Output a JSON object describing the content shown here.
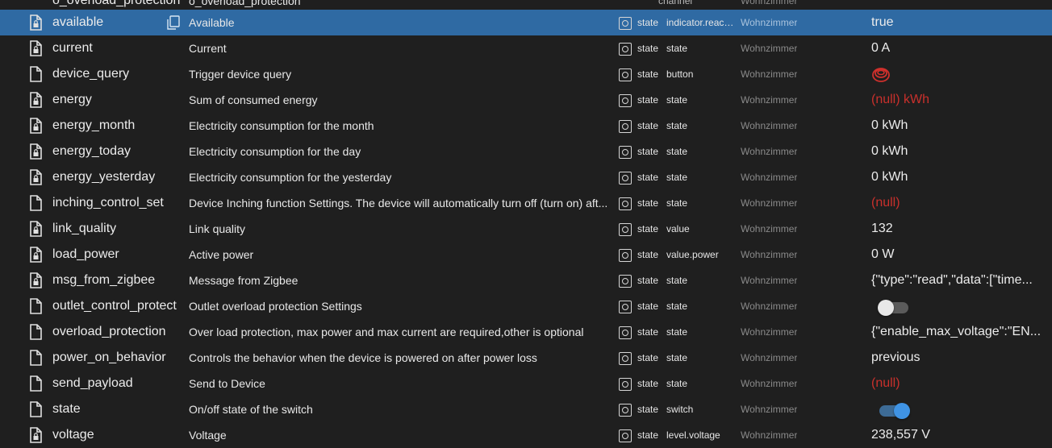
{
  "partial_row": {
    "id": "o_overload_protection",
    "name": "o_overload_protection",
    "type": "channel",
    "room": "Wohnzimmer"
  },
  "rows": [
    {
      "id": "available",
      "name": "Available",
      "type": "state",
      "role": "indicator.reach...",
      "room": "Wohnzimmer",
      "value": "true",
      "kind": "text",
      "selected": true,
      "icon": "file-lock-icon"
    },
    {
      "id": "current",
      "name": "Current",
      "type": "state",
      "role": "state",
      "room": "Wohnzimmer",
      "value": "0 A",
      "kind": "text",
      "icon": "file-lock-icon"
    },
    {
      "id": "device_query",
      "name": "Trigger device query",
      "type": "state",
      "role": "button",
      "room": "Wohnzimmer",
      "value": "",
      "kind": "button",
      "icon": "file-icon"
    },
    {
      "id": "energy",
      "name": "Sum of consumed energy",
      "type": "state",
      "role": "state",
      "room": "Wohnzimmer",
      "value": "(null) kWh",
      "kind": "null",
      "icon": "file-lock-icon"
    },
    {
      "id": "energy_month",
      "name": "Electricity consumption for the month",
      "type": "state",
      "role": "state",
      "room": "Wohnzimmer",
      "value": "0 kWh",
      "kind": "text",
      "icon": "file-lock-icon"
    },
    {
      "id": "energy_today",
      "name": "Electricity consumption for the day",
      "type": "state",
      "role": "state",
      "room": "Wohnzimmer",
      "value": "0 kWh",
      "kind": "text",
      "icon": "file-lock-icon"
    },
    {
      "id": "energy_yesterday",
      "name": "Electricity consumption for the yesterday",
      "type": "state",
      "role": "state",
      "room": "Wohnzimmer",
      "value": "0 kWh",
      "kind": "text",
      "icon": "file-lock-icon"
    },
    {
      "id": "inching_control_set",
      "name": "Device Inching function Settings. The device will automatically turn off (turn on) aft...",
      "type": "state",
      "role": "state",
      "room": "Wohnzimmer",
      "value": "(null)",
      "kind": "null",
      "icon": "file-icon"
    },
    {
      "id": "link_quality",
      "name": "Link quality",
      "type": "state",
      "role": "value",
      "room": "Wohnzimmer",
      "value": "132",
      "kind": "text",
      "icon": "file-lock-icon"
    },
    {
      "id": "load_power",
      "name": "Active power",
      "type": "state",
      "role": "value.power",
      "room": "Wohnzimmer",
      "value": "0 W",
      "kind": "text",
      "icon": "file-lock-icon"
    },
    {
      "id": "msg_from_zigbee",
      "name": "Message from Zigbee",
      "type": "state",
      "role": "state",
      "room": "Wohnzimmer",
      "value": "{\"type\":\"read\",\"data\":[\"time...",
      "kind": "text",
      "icon": "file-lock-icon"
    },
    {
      "id": "outlet_control_protect",
      "name": "Outlet overload protection Settings",
      "type": "state",
      "role": "state",
      "room": "Wohnzimmer",
      "value": "false",
      "kind": "toggle-off",
      "icon": "file-icon"
    },
    {
      "id": "overload_protection",
      "name": "Over load protection, max power and max current are required,other is optional",
      "type": "state",
      "role": "state",
      "room": "Wohnzimmer",
      "value": "{\"enable_max_voltage\":\"EN...",
      "kind": "text",
      "icon": "file-icon"
    },
    {
      "id": "power_on_behavior",
      "name": "Controls the behavior when the device is powered on after power loss",
      "type": "state",
      "role": "state",
      "room": "Wohnzimmer",
      "value": "previous",
      "kind": "text",
      "icon": "file-icon"
    },
    {
      "id": "send_payload",
      "name": "Send to Device",
      "type": "state",
      "role": "state",
      "room": "Wohnzimmer",
      "value": "(null)",
      "kind": "null",
      "icon": "file-icon"
    },
    {
      "id": "state",
      "name": "On/off state of the switch",
      "type": "state",
      "role": "switch",
      "room": "Wohnzimmer",
      "value": "true",
      "kind": "toggle-on",
      "icon": "file-icon"
    },
    {
      "id": "voltage",
      "name": "Voltage",
      "type": "state",
      "role": "level.voltage",
      "room": "Wohnzimmer",
      "value": "238,557 V",
      "kind": "text",
      "icon": "file-lock-icon"
    }
  ],
  "colors": {
    "background": "#1f1f1f",
    "selected": "#2f6aa3",
    "null_value": "#c9302c",
    "switch_on": "#3f93e4"
  }
}
